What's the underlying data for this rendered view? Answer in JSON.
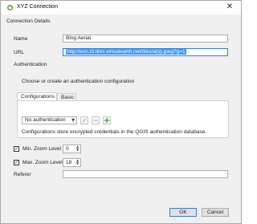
{
  "window": {
    "title": "XYZ Connection",
    "close_glyph": "✕"
  },
  "section": {
    "connection_details": "Connection Details"
  },
  "name": {
    "label": "Name",
    "value": "Bing Aerial"
  },
  "url": {
    "label": "URL",
    "value": "http://ecn.t3.tiles.virtualearth.net/tiles/a{q}.jpeg?g=1"
  },
  "authentication": {
    "group_label": "Authentication",
    "tabs": [
      {
        "label": "Configurations"
      },
      {
        "label": "Basic"
      }
    ],
    "prompt": "Choose or create an authentication configuration",
    "config_select": "No authentication",
    "info": "Configurations store encrypted credentials in the QGIS authentication database."
  },
  "zoom": {
    "min_label": "Min. Zoom Level",
    "min_value": "0",
    "min_checked": true,
    "max_label": "Max. Zoom Level",
    "max_value": "18",
    "max_checked": true
  },
  "referer": {
    "label": "Referer",
    "value": ""
  },
  "buttons": {
    "ok": "OK",
    "cancel": "Cancel"
  },
  "icons": [
    "qgis-icon",
    "close-icon",
    "edit-icon",
    "remove-icon",
    "add-icon",
    "chevron-down-icon",
    "checkmark-icon"
  ],
  "colors": {
    "accent": "#3399ff",
    "qgis_green": "#6aa84f"
  }
}
